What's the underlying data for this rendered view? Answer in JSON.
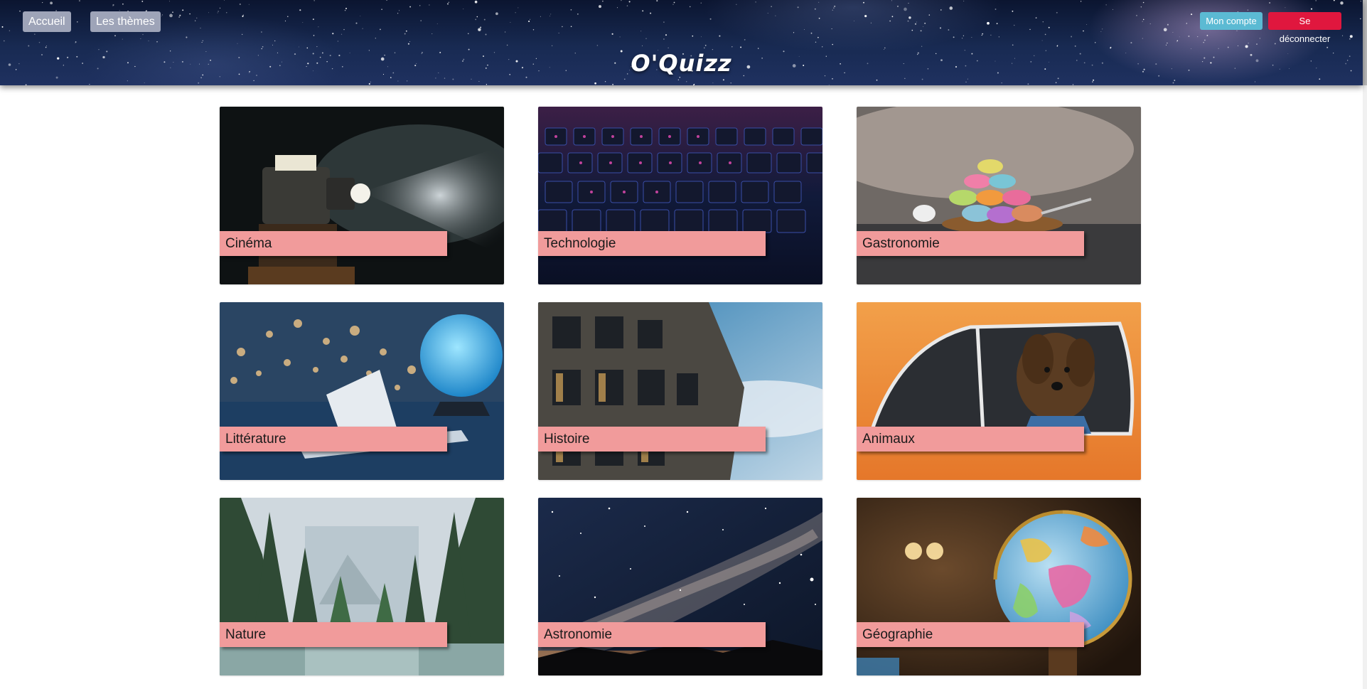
{
  "header": {
    "nav": {
      "home_label": "Accueil",
      "themes_label": "Les thèmes"
    },
    "account_label": "Mon compte",
    "logout_label": "Se déconnecter",
    "logo": "O'Quizz",
    "colors": {
      "nav_button": "#9ea4b8",
      "account_button": "#5bbad3",
      "logout_button": "#e0173e"
    }
  },
  "themes": [
    {
      "label": "Cinéma",
      "image": "film-projector"
    },
    {
      "label": "Technologie",
      "image": "keyboard"
    },
    {
      "label": "Gastronomie",
      "image": "macarons"
    },
    {
      "label": "Littérature",
      "image": "book-moon-lamp"
    },
    {
      "label": "Histoire",
      "image": "colosseum"
    },
    {
      "label": "Animaux",
      "image": "dog-in-car"
    },
    {
      "label": "Nature",
      "image": "forest-lake"
    },
    {
      "label": "Astronomie",
      "image": "milky-way"
    },
    {
      "label": "Géographie",
      "image": "globe"
    }
  ],
  "colors": {
    "label_background": "#f19b9b"
  }
}
